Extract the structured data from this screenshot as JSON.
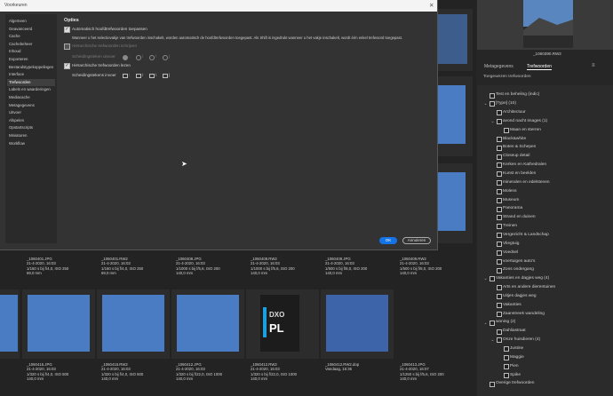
{
  "window_title": "Voorkeuren",
  "dialog": {
    "nav": [
      "Algemeen",
      "Geavanceerd",
      "Cache",
      "Cachebeheer",
      "Inhoud",
      "Exporteren",
      "Bestandstypekoppelingen",
      "Interface",
      "Trefwoorden",
      "Labels en waarderingen",
      "Mediacache",
      "Metagegevens",
      "Uitvoer",
      "Afspelen",
      "Opstartscripts",
      "Miniaturen",
      "Workflow"
    ],
    "selected_nav": "Trefwoorden",
    "section_title": "Opties",
    "opt_auto_parent": "Automatisch hoofdtrefwoorden toepassen",
    "opt_auto_desc": "Wanneer u het selectievakje van trefwoorden inschakelt, worden automatisch de hoofdtrefwoorden toegepast. Als Shift is ingedrukt wanneer u het vakje inschakelt, wordt één enkel trefwoord toegepast.",
    "opt_hier_write": "Hiërarchische trefwoorden schrijven",
    "sep_out_label": "Scheidingsteken uitvoer",
    "sep_out": [
      ":",
      "/",
      "\\",
      "|"
    ],
    "opt_hier_read": "Hiërarchische trefwoorden lezen",
    "sep_in_label": "Scheidingstekens invoer",
    "sep_in": [
      ":",
      "/",
      "\\",
      "|"
    ],
    "ok": "OK",
    "cancel": "Annuleren"
  },
  "right": {
    "preview_caption": "_1060390.RW2",
    "tab_meta": "Metagegevens",
    "tab_kw": "Trefwoorden",
    "applied_label": "Toegewezen trefwoorden",
    "keywords": [
      {
        "label": "Test en beheling (indic)",
        "indent": 0,
        "chev": ""
      },
      {
        "label": "[Type] (10)",
        "indent": 0,
        "chev": "v"
      },
      {
        "label": "Architectuur",
        "indent": 1,
        "chev": ""
      },
      {
        "label": "avond nacht images (1)",
        "indent": 1,
        "chev": "v"
      },
      {
        "label": "Maan en sterren",
        "indent": 2,
        "chev": ""
      },
      {
        "label": "Black&white",
        "indent": 1,
        "chev": ""
      },
      {
        "label": "Boten & Schepen",
        "indent": 1,
        "chev": ""
      },
      {
        "label": "Closeup detail",
        "indent": 1,
        "chev": ""
      },
      {
        "label": "Kerken en Kathedralen",
        "indent": 1,
        "chev": ""
      },
      {
        "label": "Kunst en beelden",
        "indent": 1,
        "chev": ""
      },
      {
        "label": "mineralen en edelstenen",
        "indent": 1,
        "chev": ""
      },
      {
        "label": "Molens",
        "indent": 1,
        "chev": ""
      },
      {
        "label": "Museum",
        "indent": 1,
        "chev": ""
      },
      {
        "label": "Panorama",
        "indent": 1,
        "chev": ""
      },
      {
        "label": "Strand en duinen",
        "indent": 1,
        "chev": ""
      },
      {
        "label": "Treinen",
        "indent": 1,
        "chev": ""
      },
      {
        "label": "Vergezicht & Landschap",
        "indent": 1,
        "chev": ""
      },
      {
        "label": "Vliegtuig",
        "indent": 1,
        "chev": ""
      },
      {
        "label": "Voedsel",
        "indent": 1,
        "chev": ""
      },
      {
        "label": "voertuigen auto's",
        "indent": 1,
        "chev": ""
      },
      {
        "label": "Zons ondergang",
        "indent": 1,
        "chev": ""
      },
      {
        "label": "Vakanties en dagjes weg (4)",
        "indent": 0,
        "chev": "v"
      },
      {
        "label": "Arts en andere dierentuinen",
        "indent": 1,
        "chev": ""
      },
      {
        "label": "Uitjes dagjes weg",
        "indent": 1,
        "chev": ""
      },
      {
        "label": "Vakanties",
        "indent": 1,
        "chev": ""
      },
      {
        "label": "Zaanstreek wandeling",
        "indent": 1,
        "chev": ""
      },
      {
        "label": "woning (2)",
        "indent": 0,
        "chev": "v"
      },
      {
        "label": "Dahliastraat",
        "indent": 1,
        "chev": ""
      },
      {
        "label": "Onze huisdieren (4)",
        "indent": 1,
        "chev": "v"
      },
      {
        "label": "Justine",
        "indent": 2,
        "chev": ""
      },
      {
        "label": "Maggie",
        "indent": 2,
        "chev": ""
      },
      {
        "label": "Pien",
        "indent": 2,
        "chev": ""
      },
      {
        "label": "Spike",
        "indent": 2,
        "chev": ""
      },
      {
        "label": "Overige trefwoorden",
        "indent": 0,
        "chev": ""
      }
    ]
  },
  "grid": {
    "row1": [
      {
        "name": "_1060401.JPG",
        "date": "21-4-2020, 16:03",
        "exp": "1/160 s bij f/4,0, ISO 250",
        "focal": "69,0 mm"
      },
      {
        "name": "_1060401.RW2",
        "date": "21-4-2020, 16:03",
        "exp": "1/160 s bij f/4,0, ISO 250",
        "focal": "69,0 mm"
      },
      {
        "name": "_1060408.JPG",
        "date": "21-4-2020, 16:03",
        "exp": "1/1000 s bij f/5,6, ISO 200",
        "focal": "140,0 mm"
      },
      {
        "name": "_1060408.RW2",
        "date": "21-4-2020, 16:03",
        "exp": "1/1000 s bij f/5,6, ISO 200",
        "focal": "140,0 mm"
      },
      {
        "name": "_1060409.JPG",
        "date": "21-4-2020, 16:03",
        "exp": "1/500 s bij f/8,0, ISO 200",
        "focal": "140,0 mm"
      },
      {
        "name": "_1060409.RW2",
        "date": "21-4-2020, 16:03",
        "exp": "1/500 s bij f/8,0, ISO 200",
        "focal": "140,0 mm"
      }
    ],
    "row2": [
      {
        "name": "_1060415.JPG",
        "date": "21-4-2020, 16:03",
        "exp": "1/320 s bij f/4,0, ISO 500",
        "focal": "140,0 mm"
      },
      {
        "name": "_1060415.RW2",
        "date": "21-4-2020, 16:03",
        "exp": "1/320 s bij f/4,0, ISO 500",
        "focal": "140,0 mm"
      },
      {
        "name": "_1060412.JPG",
        "date": "21-4-2020, 16:03",
        "exp": "1/320 s bij f/22,0, ISO 1000",
        "focal": "140,0 mm"
      },
      {
        "name": "_1060412.RW2",
        "date": "21-4-2020, 16:03",
        "exp": "1/320 s bij f/22,0, ISO 1000",
        "focal": "140,0 mm"
      },
      {
        "name": "_1060412.RW2.dop",
        "date": "Vandaag, 15:36",
        "exp": "",
        "focal": ""
      },
      {
        "name": "_1060413.JPG",
        "date": "21-4-2020, 16:07",
        "exp": "1/1250 s bij f/5,6, ISO 200",
        "focal": "140,0 mm"
      }
    ],
    "dxo_text_top": "DXO",
    "dxo_text_bottom": "PL"
  }
}
